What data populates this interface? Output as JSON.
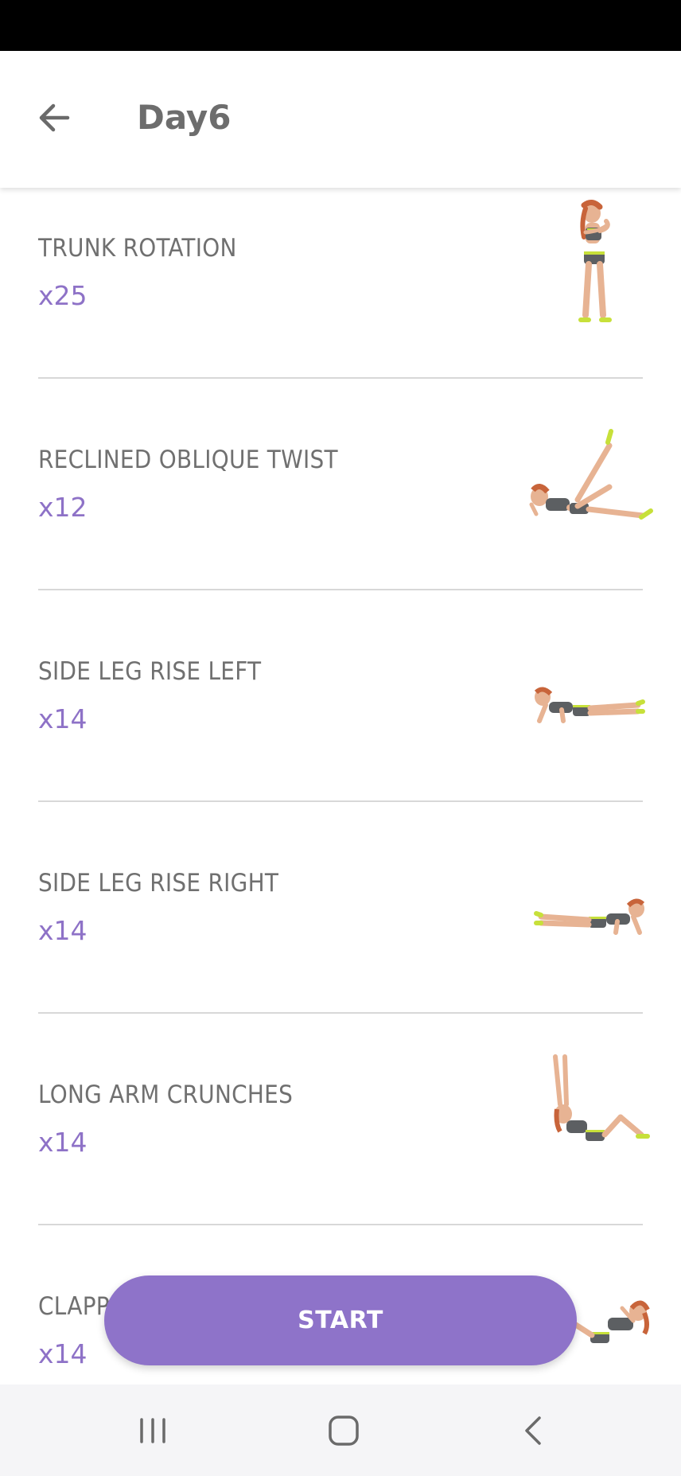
{
  "header": {
    "title": "Day6",
    "back_icon": "arrow-left-icon"
  },
  "exercises": [
    {
      "name": "TRUNK ROTATION",
      "reps": "x25",
      "pose": "standing-twist"
    },
    {
      "name": "RECLINED OBLIQUE TWIST",
      "reps": "x12",
      "pose": "reclined-leg-up"
    },
    {
      "name": "SIDE LEG RISE LEFT",
      "reps": "x14",
      "pose": "side-lying-left"
    },
    {
      "name": "SIDE LEG RISE RIGHT",
      "reps": "x14",
      "pose": "side-lying-right"
    },
    {
      "name": "LONG ARM CRUNCHES",
      "reps": "x14",
      "pose": "crunch-arms-up"
    },
    {
      "name": "CLAPPING CRUNCHES",
      "reps": "x14",
      "pose": "crunch-clap"
    }
  ],
  "start_button": {
    "label": "START"
  },
  "colors": {
    "accent": "#8e73c9",
    "reps_text": "#8e72c7",
    "name_text": "#707070",
    "divider": "#d8d8d8",
    "status_bar": "#000000",
    "nav_bar": "#f5f5f7"
  },
  "nav": {
    "recent_icon": "recent-apps-icon",
    "home_icon": "home-icon",
    "back_icon": "nav-back-icon"
  }
}
